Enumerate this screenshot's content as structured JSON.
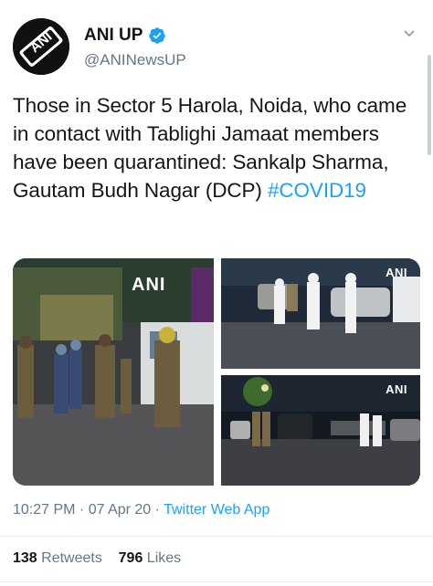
{
  "tweet": {
    "author": {
      "display_name": "ANI UP",
      "handle": "@ANINewsUP",
      "avatar_logo_text": "ANI",
      "verified": true
    },
    "text_plain": "Those in Sector 5 Harola, Noida, who came in contact with  Tablighi Jamaat members have been quarantined: Sankalp Sharma, Gautam Budh Nagar (DCP)",
    "hashtag": "#COVID19",
    "media": [
      {
        "watermark": "ANI",
        "icon": "photo-street-police"
      },
      {
        "watermark": "ANI",
        "icon": "photo-ppe-workers"
      },
      {
        "watermark": "ANI",
        "icon": "photo-night-street"
      }
    ],
    "time": "10:27 PM",
    "date": "07 Apr 20",
    "separator": " · ",
    "source": "Twitter Web App",
    "retweets_count": "138",
    "retweets_label": "Retweets",
    "likes_count": "796",
    "likes_label": "Likes"
  },
  "colors": {
    "link": "#1da1f2",
    "secondary_text": "#657786",
    "primary_text": "#14171a"
  }
}
